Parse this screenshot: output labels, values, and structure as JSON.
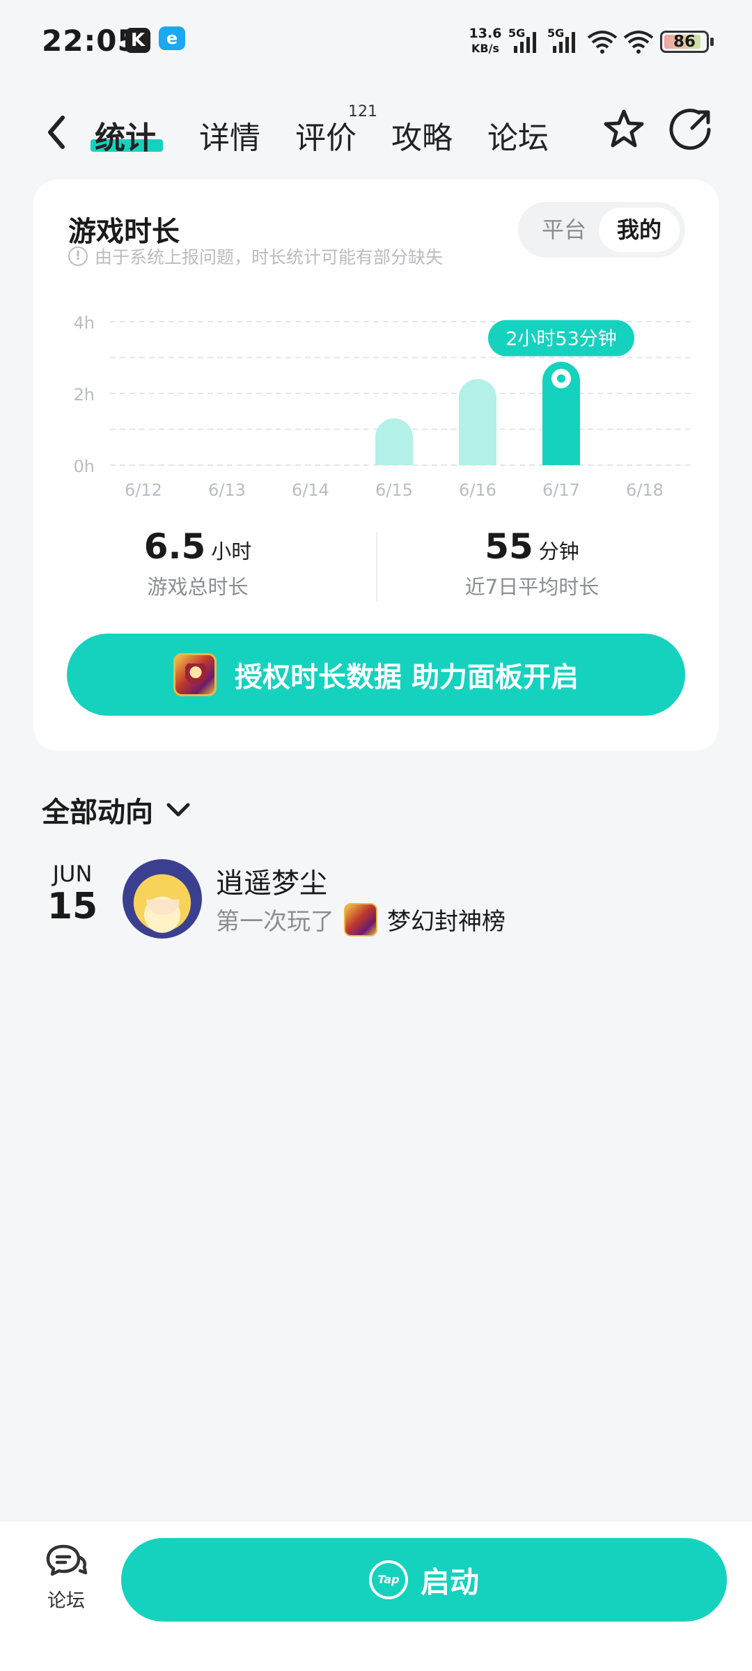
{
  "status_bar": {
    "time": "22:05",
    "app_icons": [
      "K",
      "e"
    ],
    "net_speed": "13.6",
    "net_speed_unit": "KB/s",
    "signal_1": "5G",
    "signal_2": "5G",
    "battery": "86"
  },
  "nav": {
    "tabs": [
      {
        "label": "统计",
        "active": true
      },
      {
        "label": "详情",
        "active": false
      },
      {
        "label": "评价",
        "active": false,
        "badge": "121"
      },
      {
        "label": "攻略",
        "active": false
      },
      {
        "label": "论坛",
        "active": false
      }
    ]
  },
  "playtime": {
    "title": "游戏时长",
    "note": "由于系统上报问题，时长统计可能有部分缺失",
    "segment": {
      "options": [
        "平台",
        "我的"
      ],
      "selected": "我的"
    },
    "total_value": "6.5",
    "total_unit": "小时",
    "total_label": "游戏总时长",
    "avg_value": "55",
    "avg_unit": "分钟",
    "avg_label": "近7日平均时长",
    "auth_button": "授权时长数据 助力面板开启"
  },
  "chart_data": {
    "type": "bar",
    "categories": [
      "6/12",
      "6/13",
      "6/14",
      "6/15",
      "6/16",
      "6/17",
      "6/18"
    ],
    "values": [
      0,
      0,
      0,
      1.3,
      2.4,
      2.88,
      0
    ],
    "y_ticks": [
      "4h",
      "2h",
      "0h"
    ],
    "ylim": [
      0,
      4
    ],
    "highlight_index": 5,
    "highlight_label": "2小时53分钟",
    "colors": {
      "bar": "#b2f0e8",
      "bar_highlight": "#15d2be",
      "grid": "#e3e5e8",
      "tick": "#b9bcc2"
    }
  },
  "activity": {
    "section_title": "全部动向",
    "items": [
      {
        "month": "JUN",
        "day": "15",
        "user": "逍遥梦尘",
        "action": "第一次玩了",
        "game": "梦幻封神榜"
      }
    ]
  },
  "bottom": {
    "forum_label": "论坛",
    "launch_label": "启动",
    "launch_logo": "Tap"
  },
  "colors": {
    "accent": "#15d2be",
    "background": "#f5f6f8"
  }
}
